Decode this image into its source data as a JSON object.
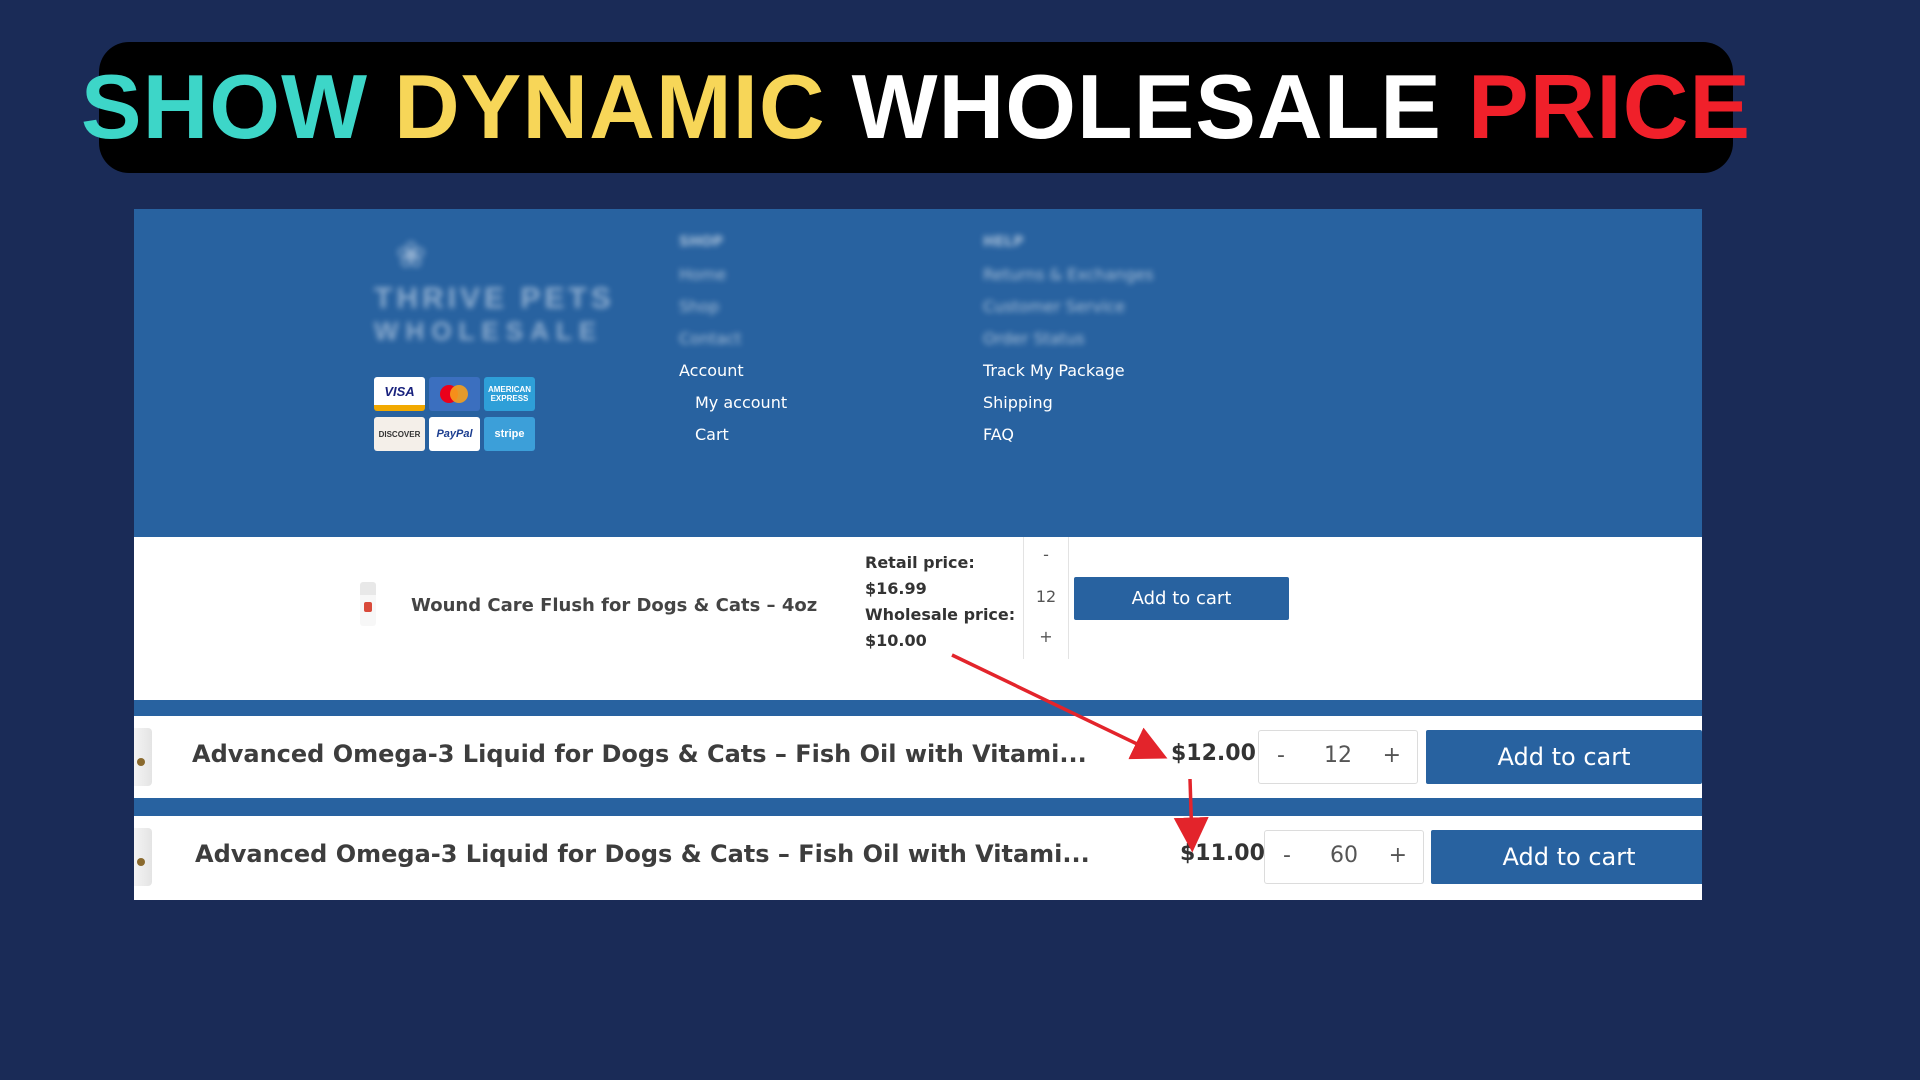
{
  "banner": {
    "word1": "SHOW",
    "word2": "DYNAMIC",
    "word3": "WHOLESALE",
    "word4": "PRICE",
    "colors": [
      "#3dd6c8",
      "#f7d658",
      "#ffffff",
      "#f0202a"
    ]
  },
  "footer": {
    "logo_line1": "THRIVE PETS",
    "logo_line2": "WHOLESALE",
    "payments": [
      "VISA",
      "Mastercard",
      "AMERICAN EXPRESS",
      "DISCOVER",
      "PayPal",
      "stripe"
    ],
    "col1": {
      "heading": "SHOP",
      "blurred": [
        "Home",
        "Shop",
        "Contact"
      ],
      "account": "Account",
      "my_account": "My account",
      "cart": "Cart"
    },
    "col2": {
      "heading": "HELP",
      "blurred": [
        "Returns & Exchanges",
        "Customer Service",
        "Order Status"
      ],
      "track": "Track My Package",
      "shipping": "Shipping",
      "faq": "FAQ"
    }
  },
  "wholesale_row": {
    "name": "Wound Care Flush for Dogs & Cats – 4oz",
    "retail_label": "Retail price:",
    "retail_price": "$16.99",
    "wholesale_label": "Wholesale price:",
    "wholesale_price": "$10.00",
    "minus": "-",
    "qty": "12",
    "plus": "+",
    "button": "Add to cart"
  },
  "products": [
    {
      "name": "Advanced Omega-3 Liquid for Dogs & Cats – Fish Oil with Vitami...",
      "price": "$12.00",
      "minus": "-",
      "qty": "12",
      "plus": "+",
      "button": "Add to cart"
    },
    {
      "name": "Advanced Omega-3 Liquid for Dogs & Cats – Fish Oil with Vitami...",
      "price": "$11.00",
      "minus": "-",
      "qty": "60",
      "plus": "+",
      "button": "Add to cart"
    }
  ],
  "colors": {
    "page_background": "#1a2b57",
    "brand_blue": "#2862a0",
    "arrow_red": "#e3242b"
  }
}
